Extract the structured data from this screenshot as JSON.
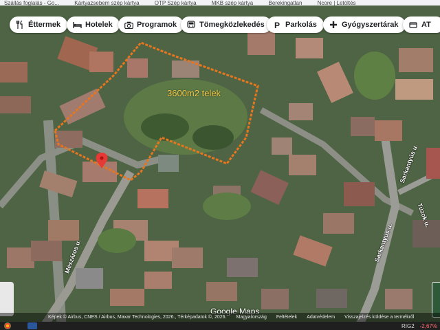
{
  "bookmarks": [
    "Szállás foglalás - Go...",
    "Kártyazsebem szép kártya",
    "OTP Szép kártya",
    "MKB szép kártya",
    "Berekingatlan",
    "Ncore | Letöltés"
  ],
  "chips": [
    {
      "label": "Éttermek",
      "icon": "restaurant-icon"
    },
    {
      "label": "Hotelek",
      "icon": "hotel-icon"
    },
    {
      "label": "Programok",
      "icon": "camera-icon"
    },
    {
      "label": "Tömegközlekedés",
      "icon": "bus-icon"
    },
    {
      "label": "Parkolás",
      "icon": "parking-icon"
    },
    {
      "label": "Gyógyszertárak",
      "icon": "pharmacy-icon"
    },
    {
      "label": "AT",
      "icon": "atm-icon"
    }
  ],
  "plot_label": "3600m2 telek",
  "streets": {
    "meszaros": "Mészáros u.",
    "sarkantyus_top": "Sarkantyús u.",
    "sarkantyus_bottom": "Sarkantyús u.",
    "tuzok": "Túzok u."
  },
  "logo": "Google Maps",
  "footer": {
    "attribution": "Képek © Airbus, CNES / Airbus, Maxar Technologies, 2026., Térképadatok ©, 2026.",
    "country": "Magyarország",
    "terms": "Feltételek",
    "privacy": "Adatvédelem",
    "feedback": "Visszajelzés küldése a termékről"
  },
  "taskbar": {
    "ticker": "RIG2",
    "change": "-2,67%"
  },
  "colors": {
    "boundary": "#e8761e",
    "pin": "#e53935",
    "label": "#f2c94c"
  }
}
